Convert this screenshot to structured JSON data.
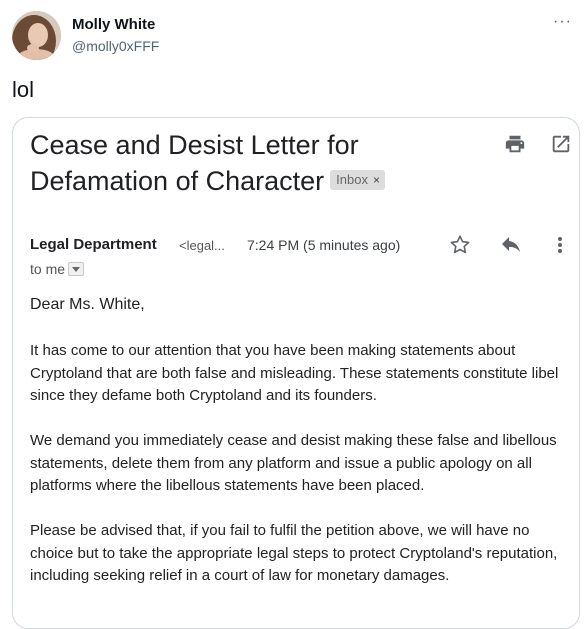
{
  "tweet": {
    "author_name": "Molly White",
    "author_handle": "@molly0xFFF",
    "more_icon": "more-horizontal-icon",
    "more_glyph": "···",
    "text": "lol"
  },
  "email": {
    "subject": "Cease and Desist Letter for Defamation of Character",
    "label_chip": "Inbox",
    "label_remove": "×",
    "sender_name": "Legal Department",
    "sender_email": "<legal...",
    "time": "7:24 PM (5 minutes ago)",
    "to_line": "to me",
    "greeting": "Dear Ms. White,",
    "paragraphs": [
      "It has come to our attention that you have been making statements about Cryptoland that are both false and misleading. These statements constitute libel since they defame both Cryptoland and its founders.",
      "We demand you immediately cease and desist making these false and libellous statements, delete them from any platform and issue a public apology on all platforms where the libellous statements have been placed.",
      "Please be advised that, if you fail to fulfil the petition above, we will have no choice but to take the appropriate legal steps to protect Cryptoland's reputation, including seeking relief in a court of law for monetary damages."
    ],
    "icons": [
      "print-icon",
      "open-in-new-window-icon",
      "star-icon",
      "reply-icon",
      "more-vertical-icon",
      "chevron-down-icon"
    ]
  },
  "colors": {
    "handle_gray": "#536471",
    "chip_bg": "#dddddd",
    "border": "#cfd9de",
    "icon_gray": "#5f6368"
  }
}
